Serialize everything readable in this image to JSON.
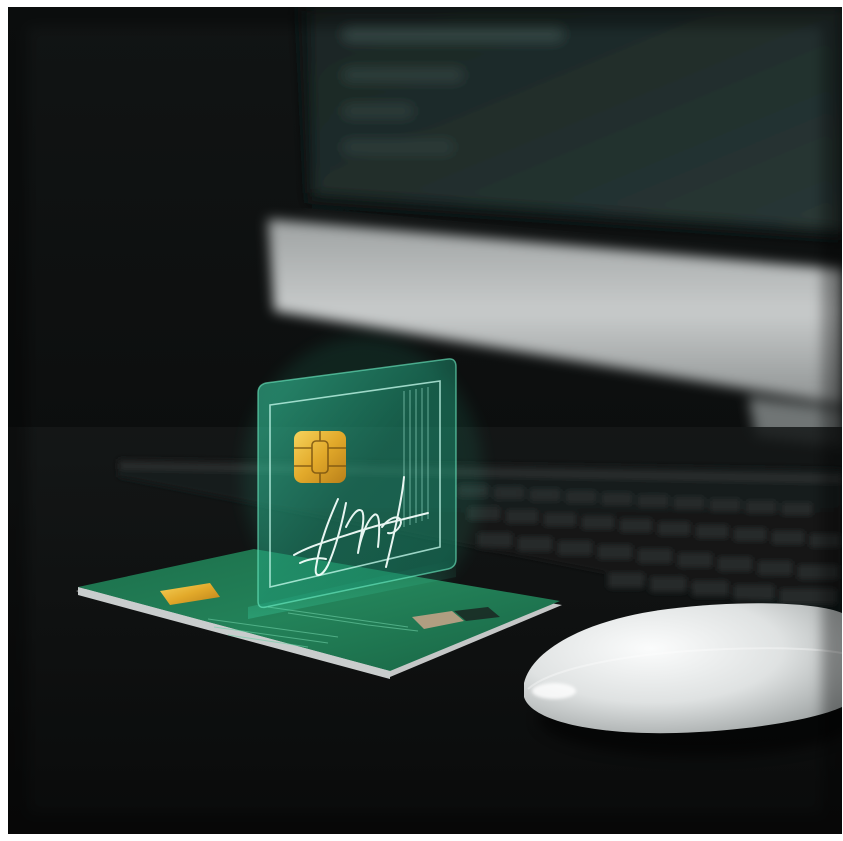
{
  "image": {
    "subject": "photo",
    "colors": {
      "background": "#0b0d0d",
      "desk": "#131515",
      "monitor_screen": "#1e2b29",
      "monitor_bezel": "#bfc2c2",
      "card_green": "#1f7a52",
      "hologram": "#2fd7a5",
      "chip_gold": "#e7b535",
      "mouse_white": "#e6e8e8"
    }
  }
}
